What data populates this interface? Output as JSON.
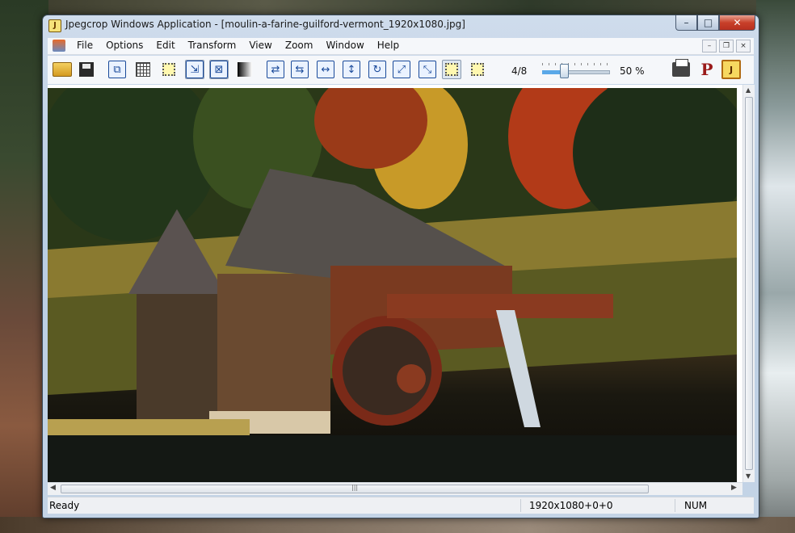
{
  "window": {
    "title": "Jpegcrop Windows Application - [moulin-a-farine-guilford-vermont_1920x1080.jpg]",
    "app_icon_letter": "J"
  },
  "caption_buttons": {
    "minimize": "–",
    "maximize": "□",
    "close": "✕"
  },
  "menu": {
    "items": [
      "File",
      "Options",
      "Edit",
      "Transform",
      "View",
      "Zoom",
      "Window",
      "Help"
    ]
  },
  "mdi_buttons": {
    "minimize": "–",
    "restore": "❐",
    "close": "×"
  },
  "toolbar": {
    "page_indicator": "4/8",
    "zoom_percent": "50 %",
    "zoom_fraction": 0.5,
    "p_label": "P",
    "j_label": "J"
  },
  "status": {
    "ready": "Ready",
    "dimensions": "1920x1080+0+0",
    "num": "NUM"
  },
  "colors": {
    "close_button": "#c8402a",
    "slider_fill": "#5aa8e8",
    "p_icon": "#9a1a1a"
  }
}
